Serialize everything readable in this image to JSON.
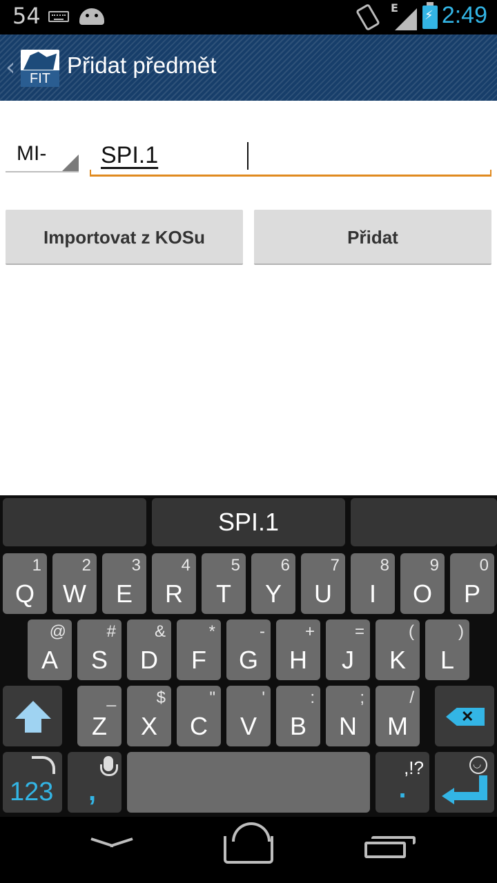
{
  "status_bar": {
    "notification_count": "54",
    "signal_label": "E",
    "time": "2:49",
    "icons": [
      "keyboard-icon",
      "android-icon",
      "vibrate-icon",
      "signal-icon",
      "battery-charging-icon"
    ]
  },
  "action_bar": {
    "logo_text": "FIT",
    "title": "Přidat předmět"
  },
  "form": {
    "prefix_spinner_value": "MI-",
    "code_input_value": "SPI.1",
    "import_button_label": "Importovat z KOSu",
    "add_button_label": "Přidat"
  },
  "keyboard": {
    "suggestions": [
      "",
      "SPI.1",
      ""
    ],
    "row1": [
      {
        "main": "Q",
        "sub": "1"
      },
      {
        "main": "W",
        "sub": "2"
      },
      {
        "main": "E",
        "sub": "3"
      },
      {
        "main": "R",
        "sub": "4"
      },
      {
        "main": "T",
        "sub": "5"
      },
      {
        "main": "Y",
        "sub": "6"
      },
      {
        "main": "U",
        "sub": "7"
      },
      {
        "main": "I",
        "sub": "8"
      },
      {
        "main": "O",
        "sub": "9"
      },
      {
        "main": "P",
        "sub": "0"
      }
    ],
    "row2": [
      {
        "main": "A",
        "sub": "@"
      },
      {
        "main": "S",
        "sub": "#"
      },
      {
        "main": "D",
        "sub": "&"
      },
      {
        "main": "F",
        "sub": "*"
      },
      {
        "main": "G",
        "sub": "-"
      },
      {
        "main": "H",
        "sub": "+"
      },
      {
        "main": "J",
        "sub": "="
      },
      {
        "main": "K",
        "sub": "("
      },
      {
        "main": "L",
        "sub": ")"
      }
    ],
    "row3": [
      {
        "main": "Z",
        "sub": "_"
      },
      {
        "main": "X",
        "sub": "$"
      },
      {
        "main": "C",
        "sub": "\""
      },
      {
        "main": "V",
        "sub": "'"
      },
      {
        "main": "B",
        "sub": ":"
      },
      {
        "main": "N",
        "sub": ";"
      },
      {
        "main": "M",
        "sub": "/"
      }
    ],
    "numbers_key_label": "123",
    "comma_key_label": ",",
    "period_key_sub": ",!?",
    "period_key_label": ".",
    "accent_color": "#33b5e5"
  },
  "colors": {
    "action_bar": "#173e6a",
    "input_underline": "#e08a1f",
    "clock": "#33b5e5"
  }
}
